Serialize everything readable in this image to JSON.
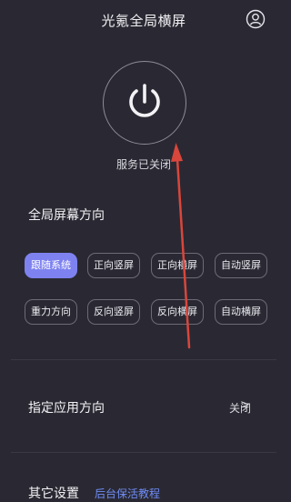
{
  "header": {
    "title": "光氪全局横屏",
    "user_icon": "user-circle-icon"
  },
  "service": {
    "power_icon": "power-icon",
    "status": "服务已关闭"
  },
  "orientation": {
    "title": "全局屏幕方向",
    "options": [
      {
        "label": "跟随系统",
        "selected": true
      },
      {
        "label": "正向竖屏",
        "selected": false
      },
      {
        "label": "正向横屏",
        "selected": false
      },
      {
        "label": "自动竖屏",
        "selected": false
      },
      {
        "label": "重力方向",
        "selected": false
      },
      {
        "label": "反向竖屏",
        "selected": false
      },
      {
        "label": "反向横屏",
        "selected": false
      },
      {
        "label": "自动横屏",
        "selected": false
      }
    ]
  },
  "app_orientation": {
    "label": "指定应用方向",
    "value": "关闭",
    "chevron": ">"
  },
  "other": {
    "label": "其它设置",
    "link": "后台保活教程"
  },
  "colors": {
    "background": "#2a2933",
    "accent": "#7e82f0",
    "annotation_arrow": "#d9463c",
    "link": "#6f8cf6"
  }
}
